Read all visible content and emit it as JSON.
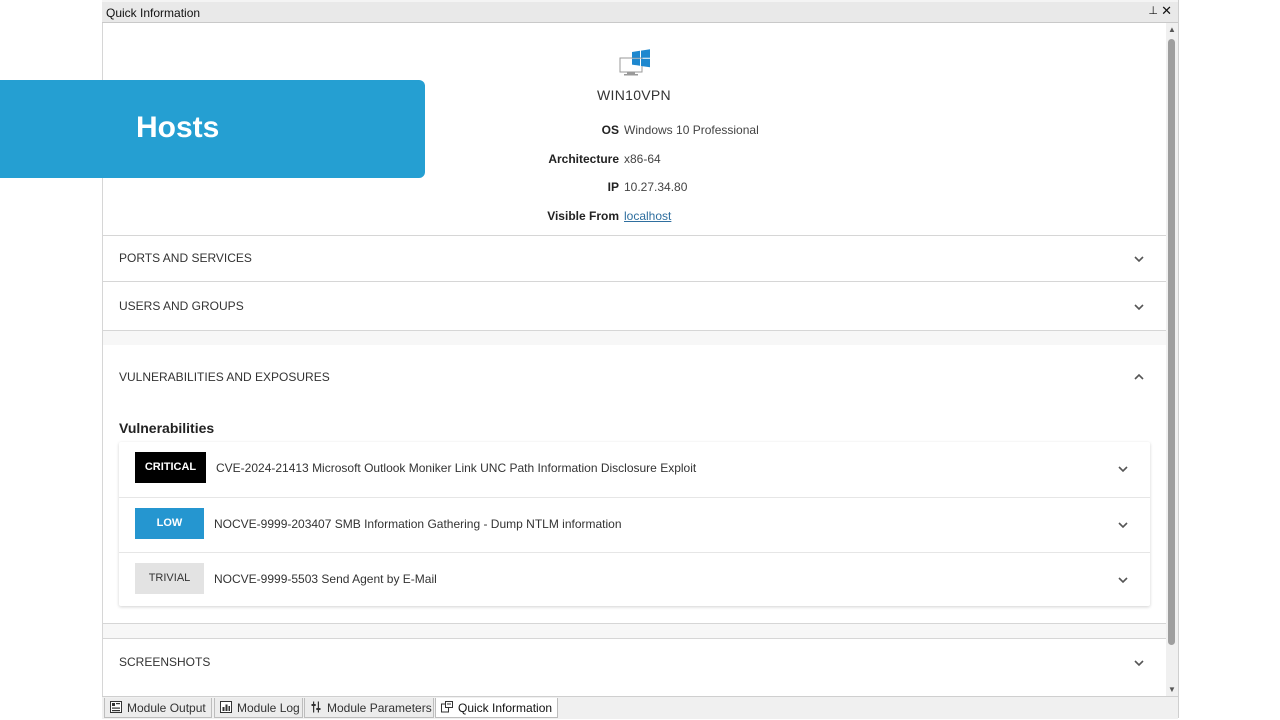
{
  "panel": {
    "title": "Quick Information",
    "pin_glyph": "⊥",
    "close_glyph": "✕"
  },
  "host": {
    "icon": "windows-monitor-icon",
    "name": "WIN10VPN",
    "os_label": "OS",
    "os_value": "Windows 10 Professional",
    "arch_label": "Architecture",
    "arch_value": "x86-64",
    "ip_label": "IP",
    "ip_value": "10.27.34.80",
    "visible_label": "Visible From",
    "visible_value": "localhost"
  },
  "sections": {
    "ports": "PORTS AND SERVICES",
    "users": "USERS AND GROUPS",
    "vulns": "VULNERABILITIES AND EXPOSURES",
    "screenshots": "SCREENSHOTS"
  },
  "vulnerabilities": {
    "heading": "Vulnerabilities",
    "items": [
      {
        "severity": "CRITICAL",
        "title": "CVE-2024-21413 Microsoft Outlook Moniker Link UNC Path Information Disclosure Exploit"
      },
      {
        "severity": "LOW",
        "title": "NOCVE-9999-203407 SMB Information Gathering - Dump NTLM information"
      },
      {
        "severity": "TRIVIAL",
        "title": "NOCVE-9999-5503 Send Agent by E-Mail"
      }
    ]
  },
  "tabs": [
    {
      "label": "Module Output",
      "icon": "module-output-icon"
    },
    {
      "label": "Module Log",
      "icon": "module-log-icon"
    },
    {
      "label": "Module Parameters",
      "icon": "module-parameters-icon"
    },
    {
      "label": "Quick Information",
      "icon": "quick-information-icon",
      "active": true
    }
  ],
  "banner": {
    "title": "Hosts"
  },
  "colors": {
    "accent": "#259fd2",
    "critical": "#000000",
    "low": "#2596d0",
    "trivial": "#e3e3e3",
    "windows_blue": "#1e88cf"
  }
}
